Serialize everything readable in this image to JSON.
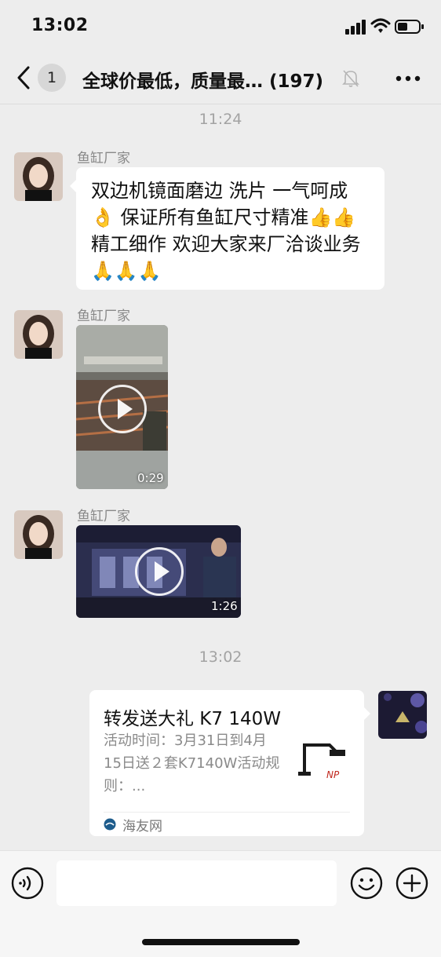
{
  "status_bar": {
    "time": "13:02"
  },
  "header": {
    "back_badge": "1",
    "title": "全球价最低，质量最… (197)"
  },
  "messages": [
    {
      "type": "timestamp",
      "text": "11:24"
    },
    {
      "type": "text",
      "sender": "鱼缸厂家",
      "text": "双边机镜面磨边 洗片 一气呵成👌 保证所有鱼缸尺寸精准👍👍 精工细作 欢迎大家来厂洽谈业务🙏🙏🙏"
    },
    {
      "type": "video",
      "sender": "鱼缸厂家",
      "duration": "0:29"
    },
    {
      "type": "video",
      "sender": "鱼缸厂家",
      "duration": "1:26"
    },
    {
      "type": "timestamp",
      "text": "13:02"
    },
    {
      "type": "link_card",
      "title": "转发送大礼 K7 140W",
      "description": "活动时间：3月31日到4月15日送２套K7140W活动规则：...",
      "source": "海友网"
    }
  ],
  "input_bar": {
    "placeholder": ""
  },
  "colors": {
    "background": "#ededed",
    "bubble": "#ffffff",
    "timestamp": "#a3a3a3"
  },
  "icons": [
    "chevron-left-icon",
    "mute-bell-icon",
    "more-icon",
    "voice-icon",
    "emoji-icon",
    "plus-icon",
    "play-icon"
  ]
}
